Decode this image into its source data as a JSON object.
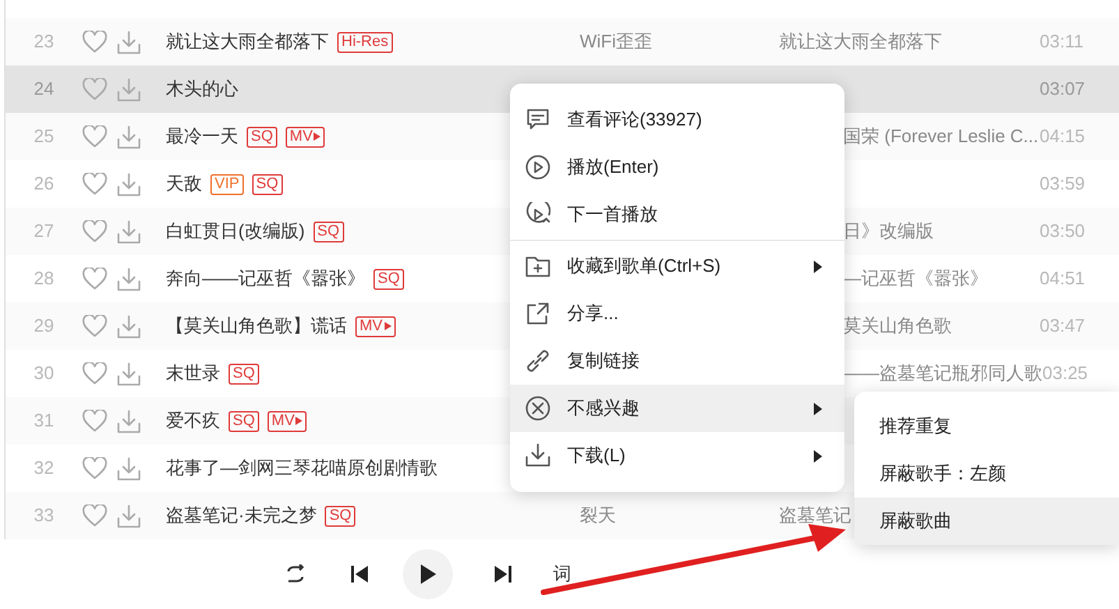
{
  "songs": [
    {
      "number": "23",
      "title": "就让这大雨全都落下",
      "tags": [
        {
          "kind": "hires",
          "text": "Hi-Res"
        }
      ],
      "artist": "WiFi歪歪",
      "album": "就让这大雨全都落下",
      "duration": "03:11",
      "selected": false,
      "covered": false
    },
    {
      "number": "24",
      "title": "木头的心",
      "duration": "03:07",
      "selected": true
    },
    {
      "number": "25",
      "title": "最冷一天",
      "tags": [
        {
          "kind": "sq",
          "text": "SQ"
        },
        {
          "kind": "mv",
          "text": "MV"
        }
      ],
      "album": "国荣 (Forever Leslie C...",
      "duration": "04:15",
      "selected": false,
      "covered": true
    },
    {
      "number": "26",
      "title": "天敌",
      "tags": [
        {
          "kind": "vip",
          "text": "VIP"
        },
        {
          "kind": "sq",
          "text": "SQ"
        }
      ],
      "duration": "03:59",
      "selected": false
    },
    {
      "number": "27",
      "title": "白虹贯日(改编版)",
      "tags": [
        {
          "kind": "sq",
          "text": "SQ"
        }
      ],
      "album": "日》改编版",
      "duration": "03:50",
      "selected": false,
      "covered": true
    },
    {
      "number": "28",
      "title": "奔向——记巫哲《嚣张》",
      "tags": [
        {
          "kind": "sq",
          "text": "SQ"
        }
      ],
      "album": "—记巫哲《嚣张》",
      "duration": "04:51",
      "selected": false,
      "covered": true
    },
    {
      "number": "29",
      "title": "【莫关山角色歌】谎话",
      "tags": [
        {
          "kind": "mv",
          "text": "MV"
        }
      ],
      "album": "莫关山角色歌",
      "duration": "03:47",
      "selected": false,
      "covered": true
    },
    {
      "number": "30",
      "title": "末世录",
      "tags": [
        {
          "kind": "sq",
          "text": "SQ"
        }
      ],
      "album": "——盗墓笔记瓶邪同人歌",
      "duration": "03:25",
      "selected": false,
      "covered": true
    },
    {
      "number": "31",
      "title": "爱不疚",
      "tags": [
        {
          "kind": "sq",
          "text": "SQ"
        },
        {
          "kind": "mv",
          "text": "MV"
        }
      ],
      "selected": false
    },
    {
      "number": "32",
      "title": "花事了—剑网三琴花喵原创剧情歌",
      "selected": false
    },
    {
      "number": "33",
      "title": "盗墓笔记·未完之梦",
      "tags": [
        {
          "kind": "sq",
          "text": "SQ"
        }
      ],
      "artist": "裂天",
      "album": "盗墓笔记",
      "selected": false,
      "covered": false
    }
  ],
  "context_menu": [
    {
      "kind": "comment",
      "label": "查看评论(33927)",
      "submenu": false,
      "selected": false
    },
    {
      "kind": "play",
      "label": "播放(Enter)",
      "submenu": false,
      "selected": false
    },
    {
      "kind": "next",
      "label": "下一首播放",
      "submenu": false,
      "selected": false
    },
    {
      "kind": "collect",
      "label": "收藏到歌单(Ctrl+S)",
      "submenu": true,
      "selected": false
    },
    {
      "kind": "share",
      "label": "分享...",
      "submenu": false,
      "selected": false
    },
    {
      "kind": "link",
      "label": "复制链接",
      "submenu": false,
      "selected": false
    },
    {
      "kind": "dislike",
      "label": "不感兴趣",
      "submenu": true,
      "selected": true
    },
    {
      "kind": "download",
      "label": "下载(L)",
      "submenu": true,
      "selected": false
    }
  ],
  "submenu": [
    {
      "label": "推荐重复",
      "selected": false
    },
    {
      "label": "屏蔽歌手：左颜",
      "selected": false
    },
    {
      "label": "屏蔽歌曲",
      "selected": true
    }
  ],
  "player": {
    "lyrics_button": "词"
  }
}
